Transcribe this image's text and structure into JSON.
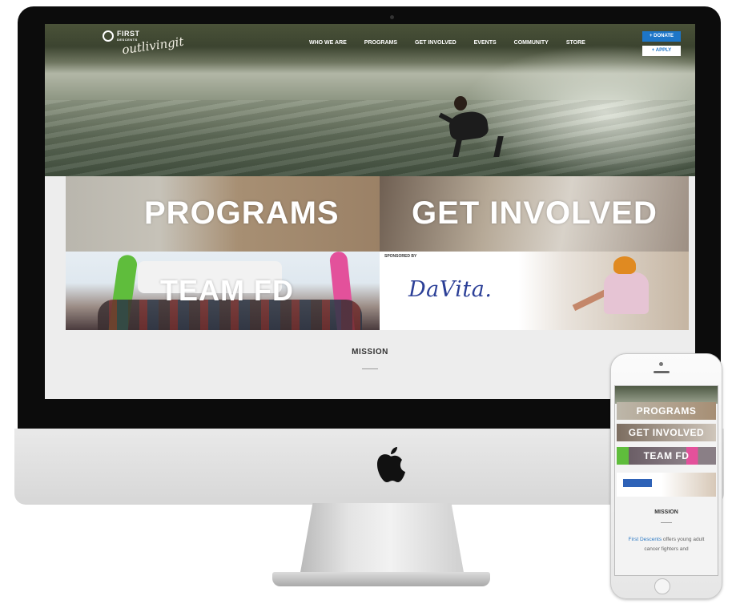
{
  "site": {
    "logo_line1": "FIRST",
    "logo_line2": "DESCENTS",
    "logo_script": "outlivingit",
    "nav": [
      "WHO WE ARE",
      "PROGRAMS",
      "GET INVOLVED",
      "EVENTS",
      "COMMUNITY",
      "STORE"
    ],
    "donate_label": "+ DONATE",
    "apply_label": "+ APPLY",
    "tiles": {
      "programs": "PROGRAMS",
      "get_involved": "GET INVOLVED",
      "team": "TEAM FD",
      "sponsor_caption": "SPONSORED BY",
      "sponsor_logo": "DaVita."
    },
    "mission_title": "MISSION"
  },
  "phone": {
    "programs": "PROGRAMS",
    "get_involved": "GET INVOLVED",
    "team": "TEAM FD",
    "mission_title": "MISSION",
    "body_link": "First Descents",
    "body_text": " offers young adult cancer fighters and"
  },
  "colors": {
    "accent_blue": "#1d76c8",
    "davita_blue": "#2b3f97",
    "board_green": "#5fbd3c",
    "board_pink": "#e3519b",
    "helmet_orange": "#e08a21"
  },
  "icons": [
    "apple-logo-icon"
  ]
}
